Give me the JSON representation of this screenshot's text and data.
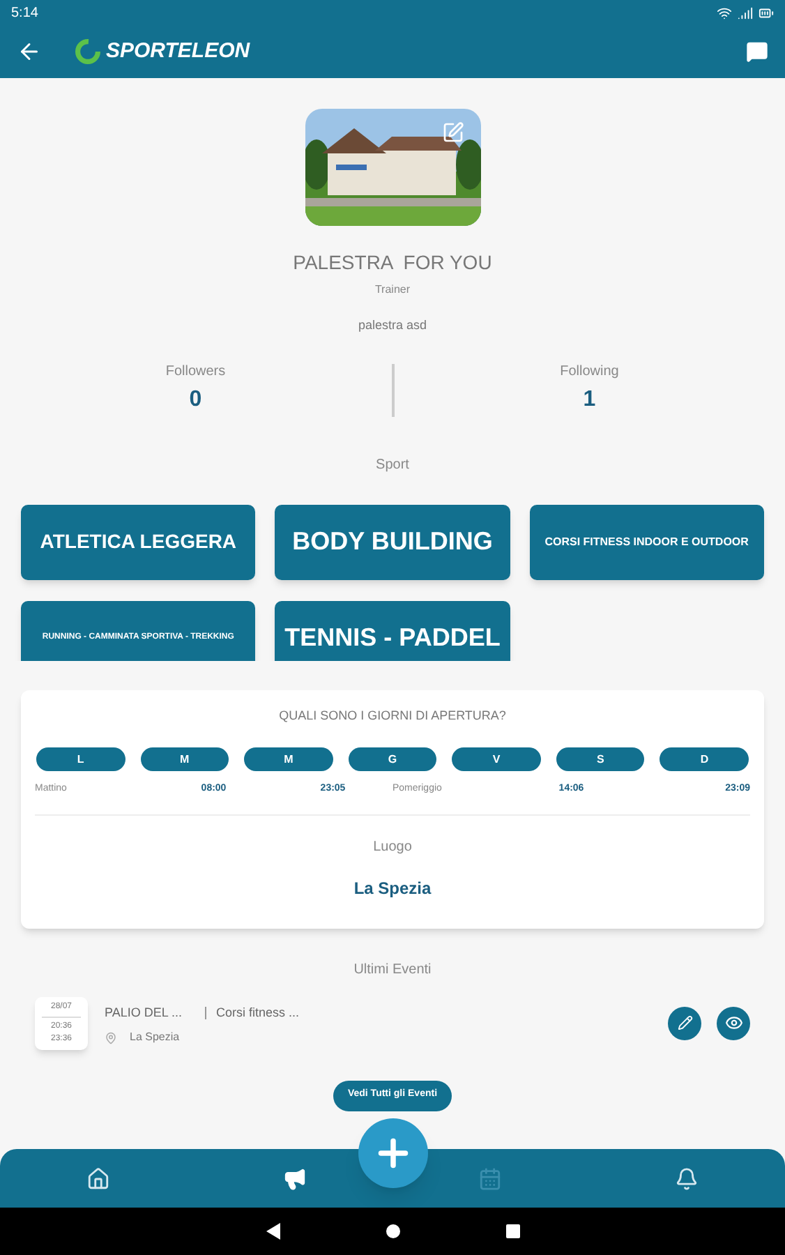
{
  "status_bar": {
    "time": "5:14"
  },
  "app_bar": {
    "logo_text": "SPORTELEON"
  },
  "profile": {
    "name": "PALESTRA  FOR YOU",
    "role": "Trainer",
    "description": "palestra asd"
  },
  "stats": [
    {
      "label": "Followers",
      "value": "0"
    },
    {
      "label": "Following",
      "value": "1"
    }
  ],
  "sport": {
    "title": "Sport",
    "items": [
      {
        "label": "ATLETICA LEGGERA"
      },
      {
        "label": "BODY BUILDING"
      },
      {
        "label": "CORSI FITNESS INDOOR E OUTDOOR"
      },
      {
        "label": "RUNNING - CAMMINATA SPORTIVA - TREKKING"
      },
      {
        "label": "TENNIS - PADDEL"
      }
    ]
  },
  "opening": {
    "title": "QUALI SONO I GIORNI DI APERTURA?",
    "days": [
      "L",
      "M",
      "M",
      "G",
      "V",
      "S",
      "D"
    ],
    "hours": [
      {
        "label": "Mattino",
        "from": "08:00",
        "to": "23:05"
      },
      {
        "label": "Pomeriggio",
        "from": "14:06",
        "to": "23:09"
      }
    ],
    "place_label": "Luogo",
    "place": "La Spezia"
  },
  "events": {
    "title": "Ultimi Eventi",
    "items": [
      {
        "date": "28/07",
        "start": "20:36",
        "end": "23:36",
        "name": "PALIO DEL ...",
        "category": "Corsi fitness ...",
        "location": "La Spezia"
      }
    ],
    "button": "Vedi Tutti gli Eventi"
  },
  "bottom_nav": [
    {
      "selected": false,
      "disabled": false
    },
    {
      "selected": true,
      "disabled": false
    },
    {
      "selected": false,
      "disabled": true
    },
    {
      "selected": false,
      "disabled": false
    }
  ]
}
